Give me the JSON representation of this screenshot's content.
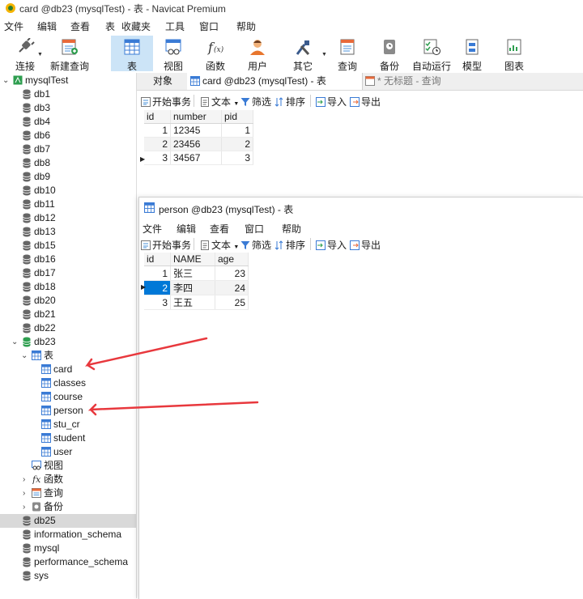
{
  "titlebar": {
    "title": "card @db23 (mysqlTest) - 表 - Navicat Premium"
  },
  "menu": [
    "文件",
    "编辑",
    "查看",
    "表",
    "收藏夹",
    "工具",
    "窗口",
    "帮助"
  ],
  "toolbar": {
    "connect": "连接",
    "new_query": "新建查询",
    "table": "表",
    "view": "视图",
    "function": "函数",
    "user": "用户",
    "other": "其它",
    "query": "查询",
    "backup": "备份",
    "automation": "自动运行",
    "model": "模型",
    "chart": "图表"
  },
  "tree": {
    "connection": "mysqlTest",
    "dbs_before": [
      "db1",
      "db3",
      "db4",
      "db6",
      "db7",
      "db8",
      "db9",
      "db10",
      "db11",
      "db12",
      "db13",
      "db15",
      "db16",
      "db17",
      "db18",
      "db20",
      "db21",
      "db22"
    ],
    "db_open": "db23",
    "tables_folder": "表",
    "tables": [
      "card",
      "classes",
      "course",
      "person",
      "stu_cr",
      "student",
      "user"
    ],
    "view_folder": "视图",
    "function_folder": "函数",
    "query_folder": "查询",
    "backup_folder": "备份",
    "dbs_after": [
      "db25",
      "information_schema",
      "mysql",
      "performance_schema",
      "sys"
    ],
    "selected": "db25"
  },
  "tabs": {
    "objects": "对象",
    "card_tab": "card @db23 (mysqlTest) - 表",
    "untitled_tab": "* 无标题 - 查询"
  },
  "strip": {
    "begin_tx": "开始事务",
    "text": "文本",
    "filter": "筛选",
    "sort": "排序",
    "import": "导入",
    "export": "导出"
  },
  "card_grid": {
    "columns": [
      "id",
      "number",
      "pid"
    ],
    "rows": [
      [
        "1",
        "12345",
        "1"
      ],
      [
        "2",
        "23456",
        "2"
      ],
      [
        "3",
        "34567",
        "3"
      ]
    ]
  },
  "person_window": {
    "title": "person @db23 (mysqlTest) - 表",
    "menu": [
      "文件",
      "编辑",
      "查看",
      "窗口",
      "帮助"
    ],
    "columns": [
      "id",
      "NAME",
      "age"
    ],
    "rows": [
      [
        "1",
        "张三",
        "23"
      ],
      [
        "2",
        "李四",
        "24"
      ],
      [
        "3",
        "王五",
        "25"
      ]
    ]
  },
  "colors": {
    "accent": "#0078d7",
    "arrow": "#e8383d",
    "selected_row": "#d9d9d9"
  }
}
